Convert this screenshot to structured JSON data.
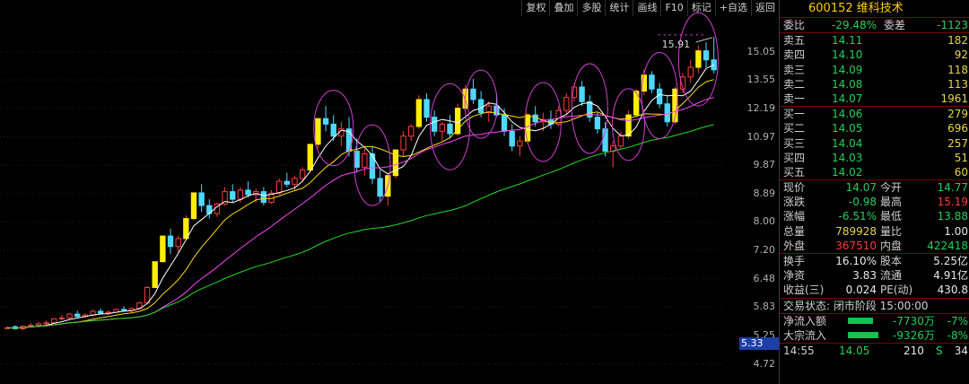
{
  "toolbar": [
    "复权",
    "叠加",
    "多股",
    "统计",
    "画线",
    "F10",
    "标记",
    "+自选",
    "返回"
  ],
  "price_axis": [
    "15.05",
    "13.55",
    "12.19",
    "10.97",
    "9.87",
    "8.89",
    "8.00",
    "7.20",
    "6.48",
    "5.83",
    "5.25",
    "4.72"
  ],
  "current_price_tag": "5.33",
  "peak_label": "15.91",
  "chart_data": {
    "type": "candlestick",
    "title": "",
    "ylim": [
      4.5,
      16.5
    ],
    "log_scale": true,
    "candles": [
      [
        5.4,
        5.42,
        5.38,
        5.4
      ],
      [
        5.42,
        5.45,
        5.36,
        5.38
      ],
      [
        5.38,
        5.44,
        5.35,
        5.43
      ],
      [
        5.43,
        5.5,
        5.4,
        5.45
      ],
      [
        5.45,
        5.52,
        5.42,
        5.48
      ],
      [
        5.48,
        5.55,
        5.45,
        5.5
      ],
      [
        5.5,
        5.6,
        5.48,
        5.58
      ],
      [
        5.58,
        5.66,
        5.55,
        5.6
      ],
      [
        5.6,
        5.7,
        5.56,
        5.68
      ],
      [
        5.68,
        5.75,
        5.6,
        5.63
      ],
      [
        5.63,
        5.7,
        5.6,
        5.66
      ],
      [
        5.66,
        5.78,
        5.62,
        5.74
      ],
      [
        5.74,
        5.8,
        5.68,
        5.7
      ],
      [
        5.7,
        5.76,
        5.66,
        5.72
      ],
      [
        5.72,
        5.8,
        5.7,
        5.78
      ],
      [
        5.78,
        5.85,
        5.74,
        5.76
      ],
      [
        5.76,
        5.82,
        5.72,
        5.8
      ],
      [
        5.8,
        5.95,
        5.78,
        5.92
      ],
      [
        5.92,
        6.3,
        5.9,
        6.27
      ],
      [
        6.27,
        6.9,
        6.25,
        6.9
      ],
      [
        6.9,
        7.59,
        6.88,
        7.59
      ],
      [
        7.59,
        7.8,
        7.1,
        7.3
      ],
      [
        7.3,
        7.6,
        7.15,
        7.52
      ],
      [
        7.52,
        8.2,
        7.48,
        8.1
      ],
      [
        8.1,
        8.91,
        8.05,
        8.91
      ],
      [
        8.91,
        9.2,
        8.3,
        8.5
      ],
      [
        8.5,
        8.7,
        8.1,
        8.25
      ],
      [
        8.25,
        8.6,
        8.15,
        8.55
      ],
      [
        8.55,
        9.1,
        8.5,
        8.95
      ],
      [
        8.95,
        9.2,
        8.6,
        8.7
      ],
      [
        8.7,
        9.1,
        8.6,
        9.0
      ],
      [
        9.0,
        9.3,
        8.75,
        8.85
      ],
      [
        8.85,
        9.05,
        8.6,
        8.95
      ],
      [
        8.95,
        9.1,
        8.5,
        8.6
      ],
      [
        8.6,
        9.0,
        8.55,
        8.9
      ],
      [
        8.9,
        9.4,
        8.85,
        9.3
      ],
      [
        9.3,
        9.6,
        9.1,
        9.2
      ],
      [
        9.2,
        9.5,
        9.0,
        9.4
      ],
      [
        9.4,
        9.8,
        9.3,
        9.7
      ],
      [
        9.7,
        10.67,
        9.6,
        10.67
      ],
      [
        10.67,
        11.74,
        10.5,
        11.74
      ],
      [
        11.74,
        12.3,
        11.2,
        11.5
      ],
      [
        11.5,
        11.9,
        10.8,
        11.0
      ],
      [
        11.0,
        11.6,
        10.6,
        11.3
      ],
      [
        11.3,
        11.8,
        10.2,
        10.4
      ],
      [
        10.4,
        10.9,
        9.6,
        9.8
      ],
      [
        9.8,
        10.5,
        9.5,
        10.3
      ],
      [
        10.3,
        10.6,
        9.2,
        9.4
      ],
      [
        9.4,
        9.7,
        8.6,
        8.8
      ],
      [
        8.8,
        9.6,
        8.5,
        9.5
      ],
      [
        9.5,
        10.45,
        9.4,
        10.45
      ],
      [
        10.45,
        11.2,
        10.2,
        11.0
      ],
      [
        11.0,
        11.5,
        10.8,
        11.4
      ],
      [
        11.4,
        12.8,
        11.3,
        12.6
      ],
      [
        12.6,
        12.9,
        11.6,
        11.8
      ],
      [
        11.8,
        12.1,
        11.0,
        11.2
      ],
      [
        11.2,
        11.6,
        10.8,
        11.5
      ],
      [
        11.5,
        11.9,
        10.9,
        11.1
      ],
      [
        11.1,
        12.4,
        11.0,
        12.2
      ],
      [
        12.2,
        13.3,
        12.0,
        13.1
      ],
      [
        13.1,
        13.6,
        12.4,
        12.6
      ],
      [
        12.6,
        13.0,
        11.8,
        12.0
      ],
      [
        12.0,
        12.5,
        11.6,
        12.3
      ],
      [
        12.3,
        12.9,
        11.8,
        11.9
      ],
      [
        11.9,
        12.2,
        11.0,
        11.2
      ],
      [
        11.2,
        11.5,
        10.4,
        10.6
      ],
      [
        10.6,
        11.0,
        10.2,
        10.8
      ],
      [
        10.8,
        12.0,
        10.7,
        11.9
      ],
      [
        11.9,
        12.3,
        11.4,
        11.6
      ],
      [
        11.6,
        12.0,
        11.2,
        11.7
      ],
      [
        11.7,
        12.1,
        11.3,
        11.5
      ],
      [
        11.5,
        12.3,
        11.4,
        12.1
      ],
      [
        12.1,
        12.9,
        11.9,
        12.7
      ],
      [
        12.7,
        13.4,
        12.5,
        13.2
      ],
      [
        13.2,
        13.5,
        12.3,
        12.5
      ],
      [
        12.5,
        12.8,
        11.6,
        11.8
      ],
      [
        11.8,
        12.0,
        11.1,
        11.3
      ],
      [
        11.3,
        11.6,
        10.2,
        10.4
      ],
      [
        10.4,
        10.8,
        9.8,
        10.6
      ],
      [
        10.6,
        11.2,
        10.5,
        11.0
      ],
      [
        11.0,
        12.1,
        10.9,
        11.9
      ],
      [
        11.9,
        13.1,
        11.8,
        13.0
      ],
      [
        13.0,
        14.1,
        12.8,
        13.8
      ],
      [
        13.8,
        14.0,
        12.9,
        13.1
      ],
      [
        13.1,
        13.4,
        12.2,
        12.4
      ],
      [
        12.4,
        12.8,
        11.4,
        11.6
      ],
      [
        11.6,
        13.2,
        11.5,
        13.1
      ],
      [
        13.1,
        13.9,
        12.9,
        13.7
      ],
      [
        13.7,
        14.6,
        13.4,
        14.2
      ],
      [
        14.2,
        15.4,
        13.9,
        15.1
      ],
      [
        15.1,
        15.6,
        14.2,
        14.6
      ],
      [
        14.6,
        15.91,
        13.88,
        14.07
      ]
    ],
    "moving_averages": [
      {
        "color": "#ffffff",
        "period": 5
      },
      {
        "color": "#ffdd00",
        "period": 10
      },
      {
        "color": "#ff44ff",
        "period": 20
      },
      {
        "color": "#22dd22",
        "period": 60
      }
    ],
    "annotation_ellipses": 10
  },
  "panel": {
    "stock_title": "600152 维科技术",
    "wei": {
      "label": "委比",
      "value": "-29.48%",
      "label2": "委差",
      "value2": "-1123"
    },
    "sell": [
      {
        "label": "卖五",
        "price": "14.11",
        "vol": "182"
      },
      {
        "label": "卖四",
        "price": "14.10",
        "vol": "92"
      },
      {
        "label": "卖三",
        "price": "14.09",
        "vol": "118"
      },
      {
        "label": "卖二",
        "price": "14.08",
        "vol": "113"
      },
      {
        "label": "卖一",
        "price": "14.07",
        "vol": "1961"
      }
    ],
    "buy": [
      {
        "label": "买一",
        "price": "14.06",
        "vol": "279"
      },
      {
        "label": "买二",
        "price": "14.05",
        "vol": "696"
      },
      {
        "label": "买三",
        "price": "14.04",
        "vol": "257"
      },
      {
        "label": "买四",
        "price": "14.03",
        "vol": "51"
      },
      {
        "label": "买五",
        "price": "14.02",
        "vol": "60"
      }
    ],
    "quote": [
      {
        "l1": "现价",
        "v1": "14.07",
        "c1": "green",
        "l2": "今开",
        "v2": "14.77",
        "c2": "green"
      },
      {
        "l1": "涨跌",
        "v1": "-0.98",
        "c1": "green",
        "l2": "最高",
        "v2": "15.19",
        "c2": "red"
      },
      {
        "l1": "涨幅",
        "v1": "-6.51%",
        "c1": "green",
        "l2": "最低",
        "v2": "13.88",
        "c2": "green"
      },
      {
        "l1": "总量",
        "v1": "789928",
        "c1": "yellow",
        "l2": "量比",
        "v2": "1.00",
        "c2": "white"
      },
      {
        "l1": "外盘",
        "v1": "367510",
        "c1": "red",
        "l2": "内盘",
        "v2": "422418",
        "c2": "green"
      }
    ],
    "fin": [
      {
        "l1": "换手",
        "v1": "16.10%",
        "l2": "股本",
        "v2": "5.25亿"
      },
      {
        "l1": "净资",
        "v1": "3.83",
        "l2": "流通",
        "v2": "4.91亿"
      },
      {
        "l1": "收益(三)",
        "v1": "0.024",
        "l2": "PE(动)",
        "v2": "430.8"
      }
    ],
    "trade_status": "交易状态: 闭市阶段 15:00:00",
    "flows": [
      {
        "label": "净流入额",
        "amount": "-7730万",
        "pct": "-7%",
        "bar_fraction": 0.7
      },
      {
        "label": "大宗流入",
        "amount": "-9326万",
        "pct": "-8%",
        "bar_fraction": 0.85
      }
    ],
    "last_tick": {
      "time": "14:55",
      "price": "14.05",
      "vol": "210",
      "side": "S",
      "num": "34"
    }
  }
}
